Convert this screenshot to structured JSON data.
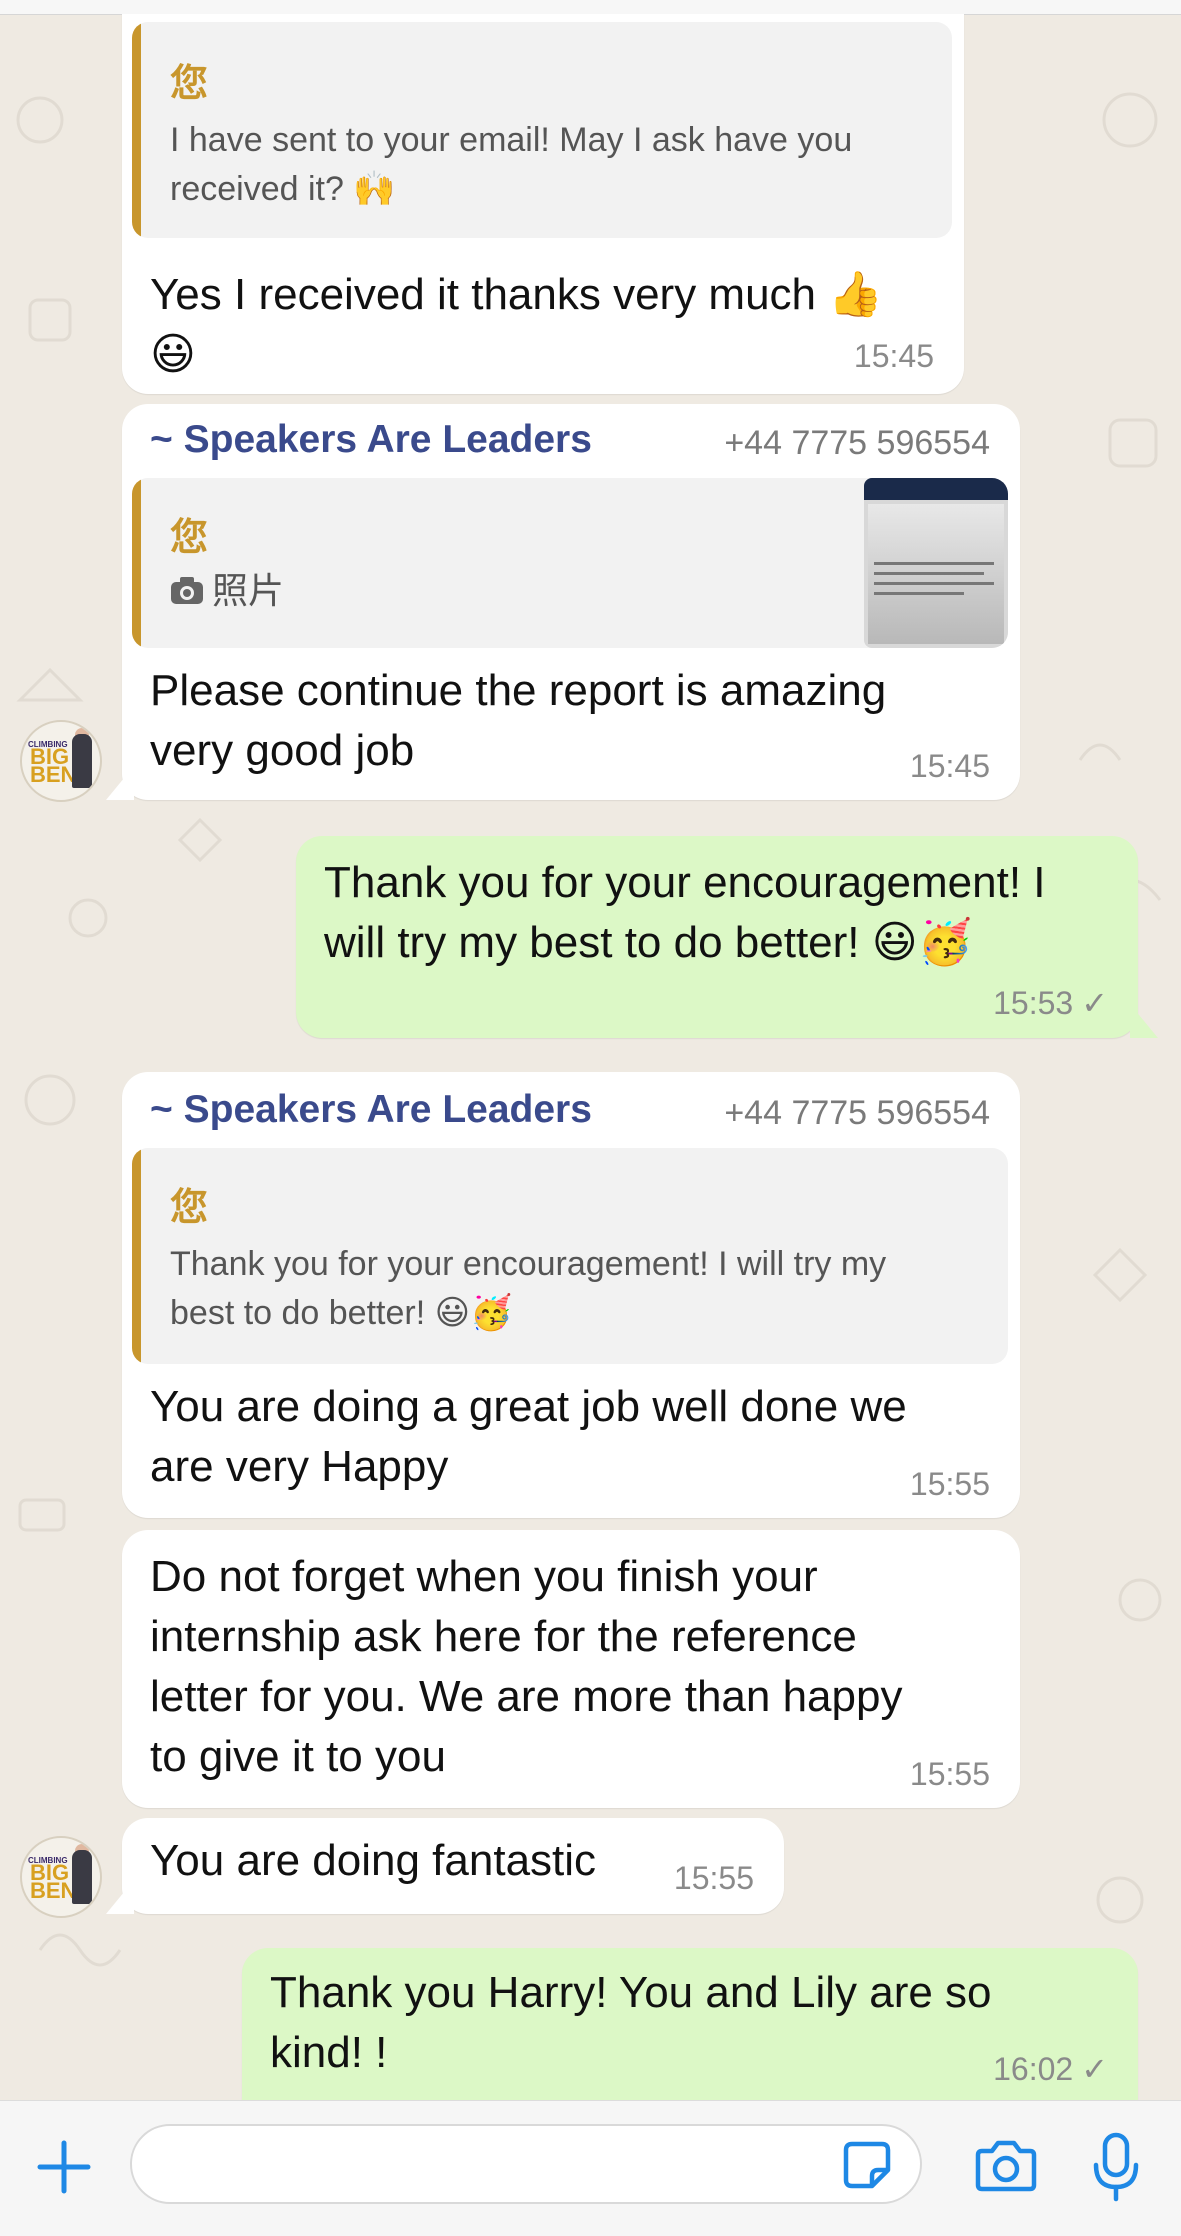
{
  "colors": {
    "incoming_bubble": "#ffffff",
    "outgoing_bubble": "#dcf8c6",
    "sender_name": "#3a4a8c",
    "quote_accent": "#c8962c",
    "accent_blue": "#1e88e5"
  },
  "messages": {
    "m1": {
      "quote_author": "您",
      "quote_text_1": "I have sent to your email!  May I ask have you",
      "quote_text_2": "received it? 🙌",
      "text_1": "Yes I received it thanks very much 👍",
      "text_2": "😃",
      "time": "15:45"
    },
    "m2": {
      "sender": "~ Speakers Are Leaders",
      "phone": "+44 7775 596554",
      "quote_author": "您",
      "quote_media_icon": "camera-icon",
      "quote_media_label": "照片",
      "text_1": "Please continue the report is amazing",
      "text_2": "very good job",
      "time": "15:45"
    },
    "m3": {
      "text_1": "Thank you for your encouragement! I",
      "text_2": "will try my best to do better!   😃🥳",
      "time": "15:53",
      "status": "✓"
    },
    "m4": {
      "sender": "~ Speakers Are Leaders",
      "phone": "+44 7775 596554",
      "quote_author": "您",
      "quote_text_1": "Thank you for your encouragement! I will try my",
      "quote_text_2": "best to do better!   😃🥳",
      "text_1": "You are doing a great job well done we",
      "text_2": "are very Happy",
      "time": "15:55"
    },
    "m5": {
      "text_1": "Do not forget when you finish your",
      "text_2": "internship ask here for the reference",
      "text_3": "letter for you. We are more than happy",
      "text_4": "to give it to you",
      "time": "15:55"
    },
    "m6": {
      "text_1": "You are doing fantastic",
      "time": "15:55"
    },
    "m7": {
      "text_1": "Thank you Harry!   You and Lily are so",
      "text_2": "kind!   !",
      "time": "16:02",
      "status": "✓"
    }
  },
  "avatar": {
    "line1": "CLIMBING",
    "line2": "BIG BEN"
  },
  "input_bar": {
    "icons": [
      "plus-icon",
      "sticker-icon",
      "camera-icon",
      "microphone-icon"
    ]
  }
}
